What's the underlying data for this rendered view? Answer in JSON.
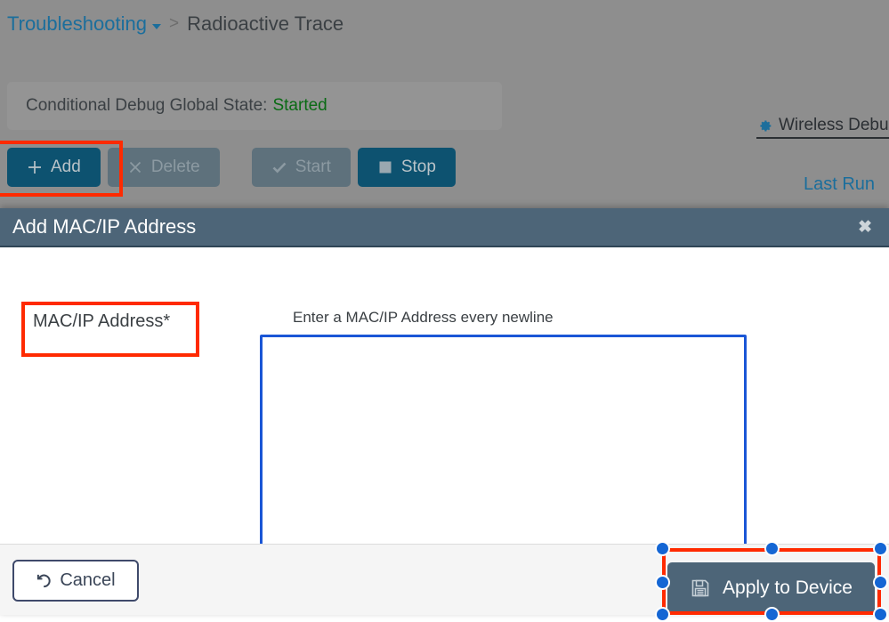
{
  "breadcrumb": {
    "parent": "Troubleshooting",
    "separator": ">",
    "current": "Radioactive Trace",
    "caret_icon": "caret-down-icon"
  },
  "status_strip": {
    "label": "Conditional Debug Global State:",
    "value": "Started",
    "value_color": "#0a6b14"
  },
  "toolbar": {
    "add_label": "Add",
    "add_icon": "plus-icon",
    "delete_label": "Delete",
    "delete_icon": "times-icon",
    "delete_disabled": true,
    "start_label": "Start",
    "start_icon": "check-icon",
    "start_disabled": true,
    "stop_label": "Stop",
    "stop_icon": "square-stop-icon"
  },
  "header_links": {
    "wireless_debug": "Wireless Debu",
    "wireless_debug_icon": "gear-icon",
    "last_run": "Last Run"
  },
  "modal": {
    "title": "Add MAC/IP Address",
    "close_icon": "close-icon",
    "field_label": "MAC/IP Address*",
    "hint": "Enter a MAC/IP Address every newline",
    "textarea_value": "",
    "textarea_placeholder": "",
    "cancel_label": "Cancel",
    "cancel_icon": "undo-icon",
    "apply_label": "Apply to Device",
    "apply_icon": "save-floppy-icon"
  },
  "colors": {
    "overlay": "#8e8e8e",
    "primary_button": "#0d5270",
    "disabled_button": "#5e717c",
    "modal_header": "#4d6578",
    "link": "#1b6e9c",
    "annotation_red": "#ff2a00",
    "handle_blue": "#1466d4",
    "focus_border": "#1a56d6"
  }
}
